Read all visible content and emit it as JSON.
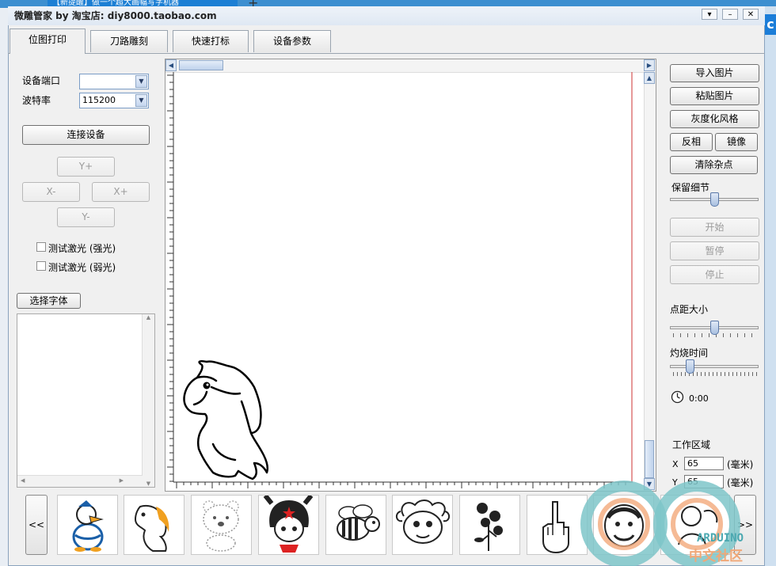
{
  "browser_tab": {
    "title": "【新提醒】做一个超大画幅写字机器"
  },
  "window": {
    "title": "微雕管家 by 淘宝店: diy8000.taobao.com"
  },
  "tabs": [
    {
      "label": "位图打印",
      "active": true
    },
    {
      "label": "刀路雕刻",
      "active": false
    },
    {
      "label": "快速打标",
      "active": false
    },
    {
      "label": "设备参数",
      "active": false
    }
  ],
  "left_panel": {
    "port_label": "设备端口",
    "port_value": "",
    "baud_label": "波特率",
    "baud_value": "115200",
    "connect_button": "连接设备",
    "jog": {
      "y_plus": "Y+",
      "x_minus": "X-",
      "x_plus": "X+",
      "y_minus": "Y-"
    },
    "test_strong": "测试激光 (强光)",
    "test_weak": "测试激光 (弱光)",
    "font_button": "选择字体"
  },
  "right_panel": {
    "import_image": "导入图片",
    "paste_image": "粘贴图片",
    "grayscale": "灰度化风格",
    "invert": "反相",
    "mirror": "镜像",
    "denoise": "清除杂点",
    "detail_label": "保留细节",
    "detail_level": 0.5,
    "start": "开始",
    "pause": "暂停",
    "stop": "停止",
    "dot_size_label": "点距大小",
    "dot_size_level": 0.5,
    "burn_time_label": "灼烧时间",
    "burn_time_level": 0.2,
    "timer": "0:00",
    "work_area_label": "工作区域",
    "x_label": "X",
    "x_value": "65",
    "x_unit": "(毫米)",
    "y_label": "Y",
    "y_value": "65",
    "y_unit": "(毫米)"
  },
  "gallery": {
    "prev": "<<",
    "next": ">>",
    "items": [
      "duck-cartoon",
      "horse-cartoon",
      "bear-cartoon",
      "girl-cartoon",
      "bee-cartoon",
      "sheep-cartoon",
      "rose-drawing",
      "hand-drawing",
      "face-drawing",
      "figure-drawing"
    ]
  },
  "watermark": {
    "text": "ARDUINO",
    "subtext": "中文社区"
  }
}
